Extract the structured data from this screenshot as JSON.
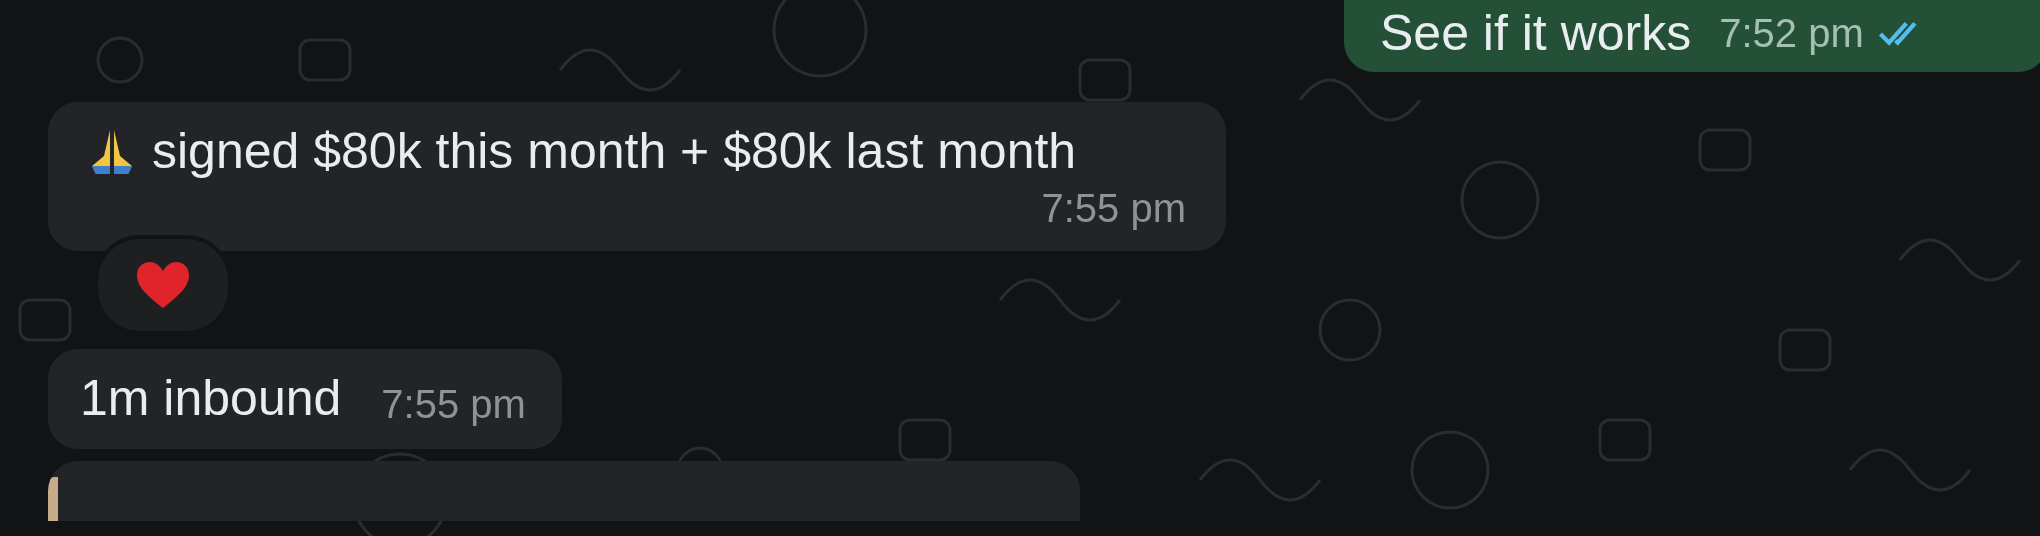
{
  "messages": [
    {
      "kind": "outgoing",
      "text": "See if it works",
      "time": "7:52 pm",
      "read": true
    },
    {
      "kind": "incoming",
      "emoji": {
        "kind": "pray"
      },
      "text": "signed $80k this month + $80k last month",
      "time": "7:55 pm",
      "reaction": {
        "kind": "heart"
      }
    },
    {
      "kind": "incoming",
      "text": "1m inbound",
      "time": "7:55 pm"
    },
    {
      "kind": "partial"
    }
  ]
}
